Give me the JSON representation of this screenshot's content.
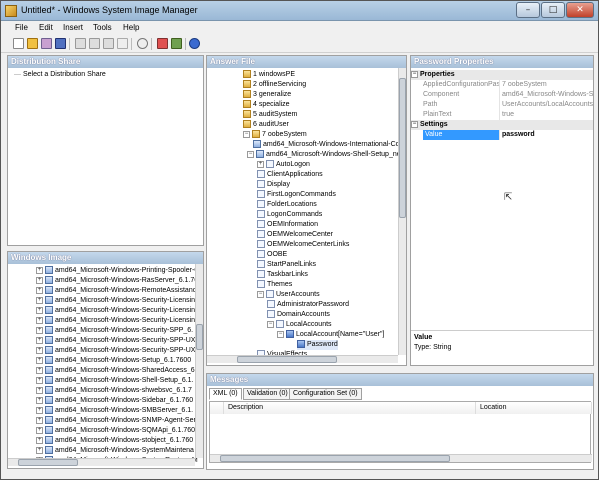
{
  "window": {
    "title": "Untitled* - Windows System Image Manager",
    "minimize": "–",
    "maximize": "□",
    "close": "✕"
  },
  "menu": [
    "File",
    "Edit",
    "Insert",
    "Tools",
    "Help"
  ],
  "distribution_share": {
    "header": "Distribution Share",
    "placeholder": "Select a Distribution Share"
  },
  "windows_image": {
    "header": "Windows Image",
    "items": [
      "amd64_Microsoft-Windows-Printing-Spooler-C",
      "amd64_Microsoft-Windows-RasServer_6.1.76",
      "amd64_Microsoft-Windows-RemoteAssistanc",
      "amd64_Microsoft-Windows-Security-Licensin",
      "amd64_Microsoft-Windows-Security-Licensin",
      "amd64_Microsoft-Windows-Security-Licensin",
      "amd64_Microsoft-Windows-Security-SPP_6.",
      "amd64_Microsoft-Windows-Security-SPP-UX",
      "amd64_Microsoft-Windows-Security-SPP-UX",
      "amd64_Microsoft-Windows-Setup_6.1.7600",
      "amd64_Microsoft-Windows-SharedAccess_6",
      "amd64_Microsoft-Windows-Shell-Setup_6.1.",
      "amd64_Microsoft-Windows-shwebsvc_6.1.7",
      "amd64_Microsoft-Windows-Sidebar_6.1.760",
      "amd64_Microsoft-Windows-SMBServer_6.1.",
      "amd64_Microsoft-Windows-SNMP-Agent-Ser",
      "amd64_Microsoft-Windows-SQMApi_6.1.760",
      "amd64_Microsoft-Windows-stobject_6.1.760",
      "amd64_Microsoft-Windows-SystemMaintena",
      "amd64_Microsoft-Windows-SystemRestore-M"
    ]
  },
  "answer_file": {
    "header": "Answer File",
    "passes": [
      "1 windowsPE",
      "2 offlineServicing",
      "3 generalize",
      "4 specialize",
      "5 auditSystem",
      "6 auditUser",
      "7 oobeSystem"
    ],
    "components": [
      "amd64_Microsoft-Windows-International-Co",
      "amd64_Microsoft-Windows-Shell-Setup_neu"
    ],
    "shell_children": [
      "AutoLogon",
      "ClientApplications",
      "Display",
      "FirstLogonCommands",
      "FolderLocations",
      "LogonCommands",
      "OEMInformation",
      "OEMWelcomeCenter",
      "OEMWelcomeCenterLinks",
      "OOBE",
      "StartPanelLinks",
      "TaskbarLinks",
      "Themes",
      "UserAccounts"
    ],
    "user_accounts_children": [
      "AdministratorPassword",
      "DomainAccounts",
      "LocalAccounts"
    ],
    "local_account": "LocalAccount[Name=\"User\"]",
    "password": "Password",
    "visual_effects": "VisualEffects"
  },
  "properties": {
    "header": "Password Properties",
    "cat_properties": "Properties",
    "rows": [
      {
        "name": "AppliedConfigurationPas",
        "value": "7 oobeSystem"
      },
      {
        "name": "Component",
        "value": "amd64_Microsoft-Windows-Shell-Setup"
      },
      {
        "name": "Path",
        "value": "UserAccounts/LocalAccounts/LocalA"
      },
      {
        "name": "PlainText",
        "value": "true"
      }
    ],
    "cat_settings": "Settings",
    "setting_name": "Value",
    "setting_value": "password",
    "desc_title": "Value",
    "desc_type": "Type: String"
  },
  "messages": {
    "header": "Messages",
    "tabs": [
      "XML (0)",
      "Validation (0)",
      "Configuration Set (0)"
    ],
    "columns": [
      "Description",
      "Location"
    ]
  },
  "colors": {
    "selection": "#3399ff",
    "pane_header": "#a8c0d8"
  }
}
